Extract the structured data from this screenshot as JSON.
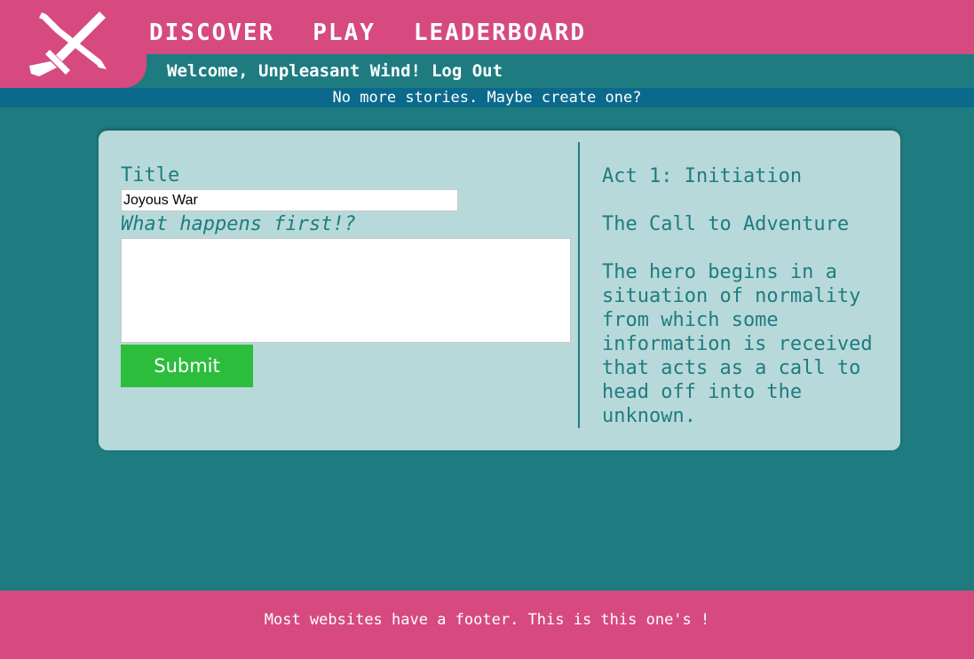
{
  "nav": {
    "discover": "DISCOVER",
    "play": "PLAY",
    "leaderboard": "LEADERBOARD"
  },
  "user_bar": {
    "welcome": "Welcome, Unpleasant Wind!",
    "logout": "Log Out"
  },
  "notice": "No more stories. Maybe create one?",
  "form": {
    "title_label": "Title",
    "title_value": "Joyous War",
    "prompt_label": "What happens first!?",
    "story_value": "",
    "submit_label": "Submit"
  },
  "act": {
    "heading": "Act 1: Initiation",
    "stage": "The Call to Adventure",
    "description": "The hero begins in a situation of normality from which some information is received that acts as a call to head off into the unknown."
  },
  "footer": "Most websites have a footer. This is this one's !",
  "colors": {
    "brand_pink": "#d64a80",
    "teal": "#1e7c80",
    "notice_blue": "#0b6a8c",
    "card_bg": "#b8d9d9",
    "submit_green": "#2dbd3d"
  },
  "icons": {
    "logo": "crossed-sword-and-pencil-icon"
  }
}
